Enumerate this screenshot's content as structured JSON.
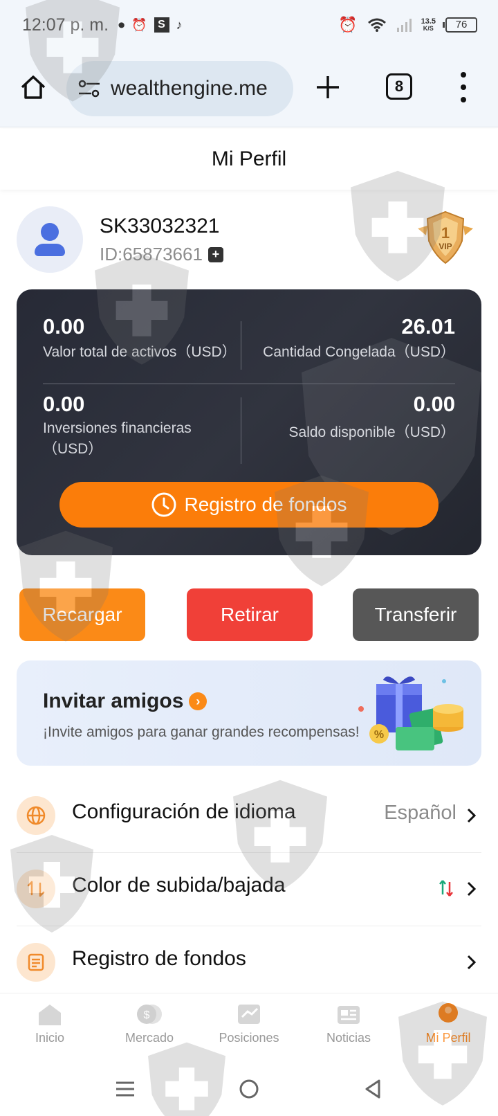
{
  "status_bar": {
    "time": "12:07 p. m.",
    "app_badge": "S",
    "network_speed_value": "13.5",
    "network_speed_unit": "K/S",
    "battery": "76"
  },
  "browser": {
    "url": "wealthengine.me",
    "tab_count": "8"
  },
  "page": {
    "title": "Mi Perfil"
  },
  "profile": {
    "username": "SK33032321",
    "id": "ID:65873661",
    "vip_level": "1",
    "vip_text": "VIP"
  },
  "assets": {
    "total_value": "0.00",
    "total_label": "Valor total de activos（USD）",
    "frozen_value": "26.01",
    "frozen_label": "Cantidad Congelada（USD）",
    "investments_value": "0.00",
    "investments_label_line1": "Inversiones financieras",
    "investments_label_line2": "（USD）",
    "available_value": "0.00",
    "available_label": "Saldo disponible（USD）",
    "fund_record_button": "Registro de fondos"
  },
  "actions": {
    "recharge": "Recargar",
    "withdraw": "Retirar",
    "transfer": "Transferir"
  },
  "invite": {
    "title": "Invitar amigos",
    "subtitle": "¡Invite amigos para ganar grandes recompensas!"
  },
  "settings": [
    {
      "label": "Configuración de idioma",
      "value": "Español",
      "icon": "globe-icon"
    },
    {
      "label": "Color de subida/bajada",
      "value": "",
      "icon": "swap-icon"
    },
    {
      "label": "Registro de fondos",
      "value": "",
      "icon": "document-icon"
    }
  ],
  "bottom_nav": [
    {
      "label": "Inicio",
      "icon": "home-icon",
      "active": false
    },
    {
      "label": "Mercado",
      "icon": "market-icon",
      "active": false
    },
    {
      "label": "Posiciones",
      "icon": "positions-icon",
      "active": false
    },
    {
      "label": "Noticias",
      "icon": "news-icon",
      "active": false
    },
    {
      "label": "Mi Perfil",
      "icon": "profile-icon",
      "active": true
    }
  ],
  "colors": {
    "accent": "#fb7d0a",
    "withdraw": "#f04038",
    "transfer": "#575757",
    "card_bg": "#272a36"
  }
}
